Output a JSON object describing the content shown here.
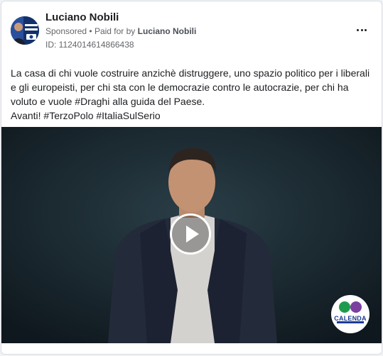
{
  "advertiser": {
    "name": "Luciano Nobili",
    "sponsored_label": "Sponsored",
    "separator": "•",
    "paid_for_by_label": "Paid for by",
    "paid_for_by_name": "Luciano Nobili",
    "id_text": "ID: 1124014614866438",
    "avatar_text_line1": "LUCIANO",
    "avatar_text_line2": "NOBILI"
  },
  "menu": {
    "icon": "more-dots-icon"
  },
  "post": {
    "lines": [
      "La casa di chi vuole costruire anzichè distruggere, uno spazio politico per i liberali",
      "e gli europeisti, per chi sta con le democrazie contro le autocrazie, per chi ha",
      "voluto e vuole #Draghi alla guida del Paese.",
      "Avanti! #TerzoPolo #ItaliaSulSerio"
    ]
  },
  "media": {
    "type": "video",
    "play_icon": "play-icon",
    "logo_text": "CALENDA"
  },
  "colors": {
    "text_primary": "#1c1e21",
    "text_secondary": "#65676b",
    "video_background": "#152129",
    "logo_blue": "#1d3b8f"
  }
}
